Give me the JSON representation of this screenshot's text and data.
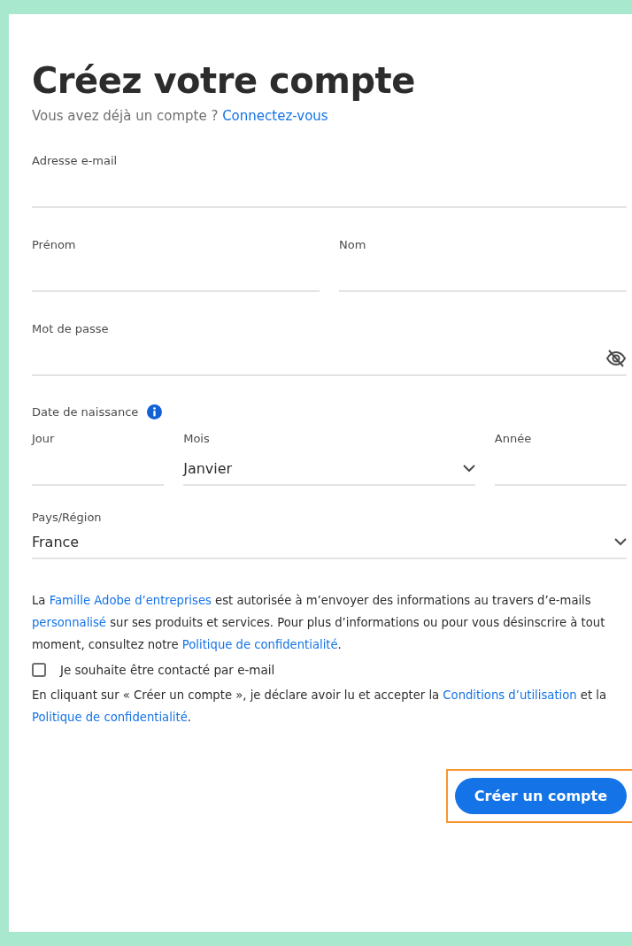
{
  "title": "Créez votre compte",
  "signin": {
    "prompt": "Vous avez déjà un compte ?",
    "link": "Connectez-vous"
  },
  "email": {
    "label": "Adresse e-mail"
  },
  "name_fields": [
    {
      "label": "Prénom"
    },
    {
      "label": "Nom"
    }
  ],
  "password": {
    "label": "Mot de passe",
    "masked": true
  },
  "birthdate": {
    "label": "Date de naissance",
    "fields": [
      {
        "label": "Jour",
        "kind": "text"
      },
      {
        "label": "Mois",
        "kind": "select",
        "value": "Janvier"
      },
      {
        "label": "Année",
        "kind": "text"
      }
    ]
  },
  "country": {
    "label": "Pays/Région",
    "value": "France"
  },
  "consent_text": [
    {
      "kind": "text",
      "text": "La "
    },
    {
      "kind": "link",
      "text": "Famille Adobe d’entreprises"
    },
    {
      "kind": "text",
      "text": " est autorisée à m’envoyer des informations au travers d’e-mails "
    },
    {
      "kind": "link",
      "text": "personnalisé"
    },
    {
      "kind": "text",
      "text": " sur ses produits et services. Pour plus d’informations ou pour vous désinscrire à tout moment, consultez notre "
    },
    {
      "kind": "link",
      "text": "Politique de confidentialité"
    },
    {
      "kind": "text",
      "text": "."
    }
  ],
  "contact_checkbox": {
    "label": "Je souhaite être contacté par e-mail",
    "checked": false
  },
  "terms_text": [
    {
      "kind": "text",
      "text": "En cliquant sur « Créer un compte », je déclare avoir lu et accepter la "
    },
    {
      "kind": "link",
      "text": "Conditions d’utilisation"
    },
    {
      "kind": "text",
      "text": " et la "
    },
    {
      "kind": "link",
      "text": "Politique de confidentialité"
    },
    {
      "kind": "text",
      "text": "."
    }
  ],
  "submit": {
    "label": "Créer un compte",
    "highlighted": true
  }
}
